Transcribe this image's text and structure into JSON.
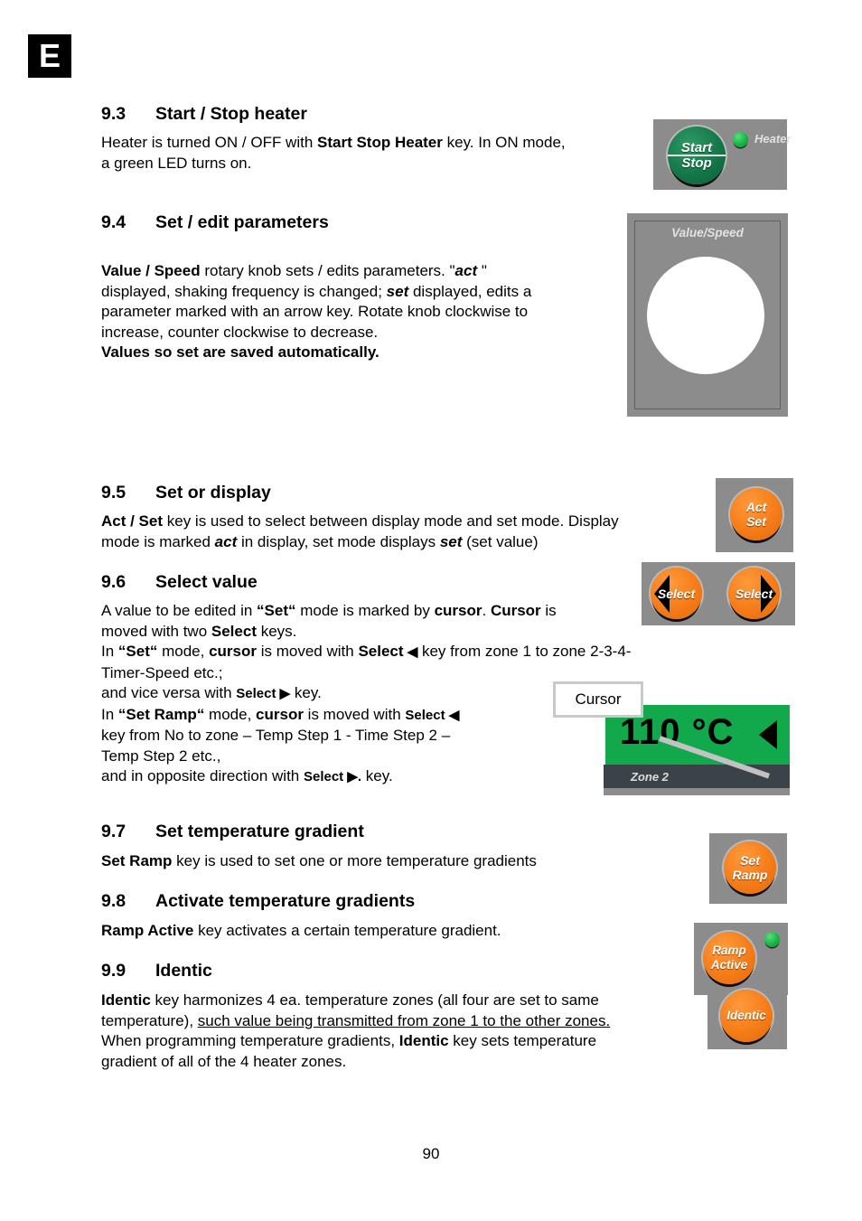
{
  "page": {
    "language_badge": "E",
    "page_number": "90"
  },
  "sections": [
    {
      "number": "9.3",
      "title": "Start / Stop heater",
      "paragraph": "Heater is turned ON / OFF with Start Stop Heater key. In ON mode, a green LED turns on."
    },
    {
      "number": "9.4",
      "title": "Set / edit parameters",
      "paragraph": "Value / Speed rotary knob sets / edits parameters. \"act \" displayed, shaking frequency is changed; set displayed, edits a parameter marked with an arrow key. Rotate knob clockwise to increase, counter clockwise to decrease. Values so set are saved automatically."
    },
    {
      "number": "9.5",
      "title": "Set or display",
      "paragraph": "Act / Set key is used to select between display mode and set mode. Display mode is marked act in display, set mode displays set (set value)"
    },
    {
      "number": "9.6",
      "title": "Select value",
      "paragraph": "A value to be edited in “Set“ mode is marked by cursor. Cursor is moved with two Select keys."
    },
    {
      "number": "9.7",
      "title": "Set temperature gradient",
      "paragraph": "Set Ramp key is used to set one or more temperature gradients"
    },
    {
      "number": "9.8",
      "title": "Activate temperature gradients",
      "paragraph": "Ramp Active key activates a certain temperature gradient."
    },
    {
      "number": "9.9",
      "title": "Identic",
      "paragraph": "Identic key harmonizes 4 ea. temperature zones (all four are set to same temperature), such value being transmitted from zone 1 to the other zones. When programming temperature gradients, Identic key sets temperature gradient of all of the 4 heater zones."
    }
  ],
  "text_runs": {
    "s93": {
      "l1a": "Heater is turned ON / OFF with ",
      "l1b": "Start Stop Heater",
      "l1c": " key. In ON mode,",
      "l2": "a green LED turns on."
    },
    "s94": {
      "l1a": "Value / Speed",
      "l1b": " rotary knob sets / edits parameters. \"",
      "l1c": "act",
      "l1d": " \"",
      "l2a": "displayed, shaking frequency is changed; ",
      "l2b": "set",
      "l2c": " displayed, edits a",
      "l3": "parameter marked with an arrow key. Rotate knob clockwise to",
      "l4": "increase, counter clockwise to decrease.",
      "l5": "Values so set are saved automatically."
    },
    "s95": {
      "l1a": "Act / Set",
      "l1b": " key is used to select between display mode and set mode. Display",
      "l2a": "mode is marked ",
      "l2b": "act",
      "l2c": " in display, set mode displays ",
      "l2d": "set",
      "l2e": " (set value)"
    },
    "s96": {
      "l1a": "A value to be edited in ",
      "l1b": "“Set“",
      "l1c": " mode is marked by ",
      "l1d": "cursor",
      "l1e": ". ",
      "l1f": "Cursor",
      "l1g": " is",
      "l2a": "moved with two ",
      "l2b": "Select",
      "l2c": "  keys.",
      "l3a": "In ",
      "l3b": "“Set“",
      "l3c": " mode, ",
      "l3d": "cursor",
      "l3e": " is moved with  ",
      "l3f": "Select",
      "l3g": " ◀",
      "l3h": " key  from zone 1 to zone 2-3-4-",
      "l4": "Timer-Speed etc.;",
      "l5a": "and vice versa with ",
      "l5b": "Select ▶",
      "l5c": "  key.",
      "l6a": "In ",
      "l6b": "“Set Ramp“",
      "l6c": " mode, ",
      "l6d": "cursor",
      "l6e": " is moved with ",
      "l6f": "Select ◀",
      "l7": "key from No to zone – Temp Step 1 - Time Step 2 –",
      "l8": "Temp Step 2 etc.,",
      "l9a": "and in opposite direction with ",
      "l9b": "Select ▶.",
      "l9c": " key."
    },
    "s97": {
      "l1a": "Set Ramp",
      "l1b": " key is used to set one or more temperature gradients"
    },
    "s98": {
      "l1a": "Ramp Active",
      "l1b": " key activates a certain temperature gradient."
    },
    "s99": {
      "l1a": "Identic",
      "l1b": " key harmonizes 4 ea. temperature zones (all four are set to same",
      "l2a": "temperature), ",
      "l2b": "such value being transmitted from zone 1 to the other zones.",
      "l3a": "When programming temperature gradients, ",
      "l3b": "Identic",
      "l3c": " key sets temperature",
      "l4": "gradient of all of the 4 heater zones."
    }
  },
  "hardware": {
    "start_stop": {
      "button_line1": "Start",
      "button_line2": "Stop",
      "led_label": "Heater"
    },
    "value_speed": {
      "label": "Value/Speed"
    },
    "act_set": {
      "line1": "Act",
      "line2": "Set"
    },
    "select_left": {
      "label": "Select"
    },
    "select_right": {
      "label": "Select"
    },
    "display": {
      "callout": "Cursor",
      "value": "110 °C",
      "zone_label": "Zone 2"
    },
    "set_ramp": {
      "line1": "Set",
      "line2": "Ramp"
    },
    "ramp_active": {
      "line1": "Ramp",
      "line2": "Active"
    },
    "identic": {
      "label": "Identic"
    }
  },
  "colors": {
    "panel_gray": "#8b8c8b",
    "button_green": "#147849",
    "button_orange": "#f57c18",
    "led_green": "#17b544",
    "lcd_green": "#12a84c",
    "lcd_bar": "#3c4348",
    "callout_border": "#c9c9c9"
  }
}
